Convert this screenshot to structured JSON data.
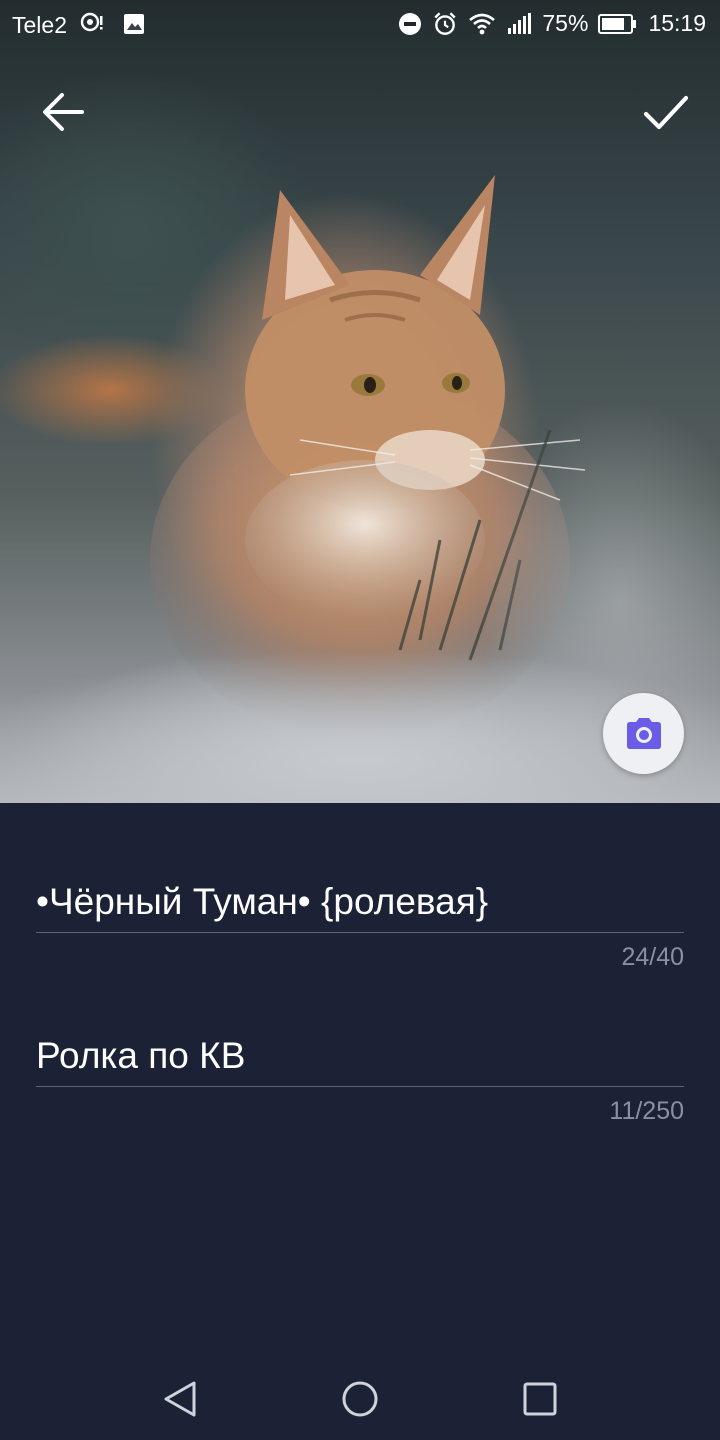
{
  "status_bar": {
    "carrier": "Tele2",
    "battery_percent": "75%",
    "time": "15:19",
    "icons": [
      "location-alert-icon",
      "image-notification-icon",
      "do-not-disturb-icon",
      "alarm-icon",
      "wifi-icon",
      "signal-icon",
      "battery-icon"
    ]
  },
  "header": {
    "back_icon": "arrow-left-icon",
    "confirm_icon": "checkmark-icon"
  },
  "photo": {
    "subject": "cat-photo",
    "camera_icon": "camera-icon",
    "camera_color": "#6b5ce7"
  },
  "form": {
    "name": {
      "value": "•Чёрный Туман• {ролевая}",
      "counter": "24/40"
    },
    "description": {
      "value": "Ролка по КВ",
      "counter": "11/250"
    }
  },
  "nav_bar": {
    "icons": [
      "nav-back-icon",
      "nav-home-icon",
      "nav-recents-icon"
    ]
  },
  "colors": {
    "background": "#1c2235",
    "divider": "#5c6476",
    "counter_text": "#8a90a0"
  }
}
